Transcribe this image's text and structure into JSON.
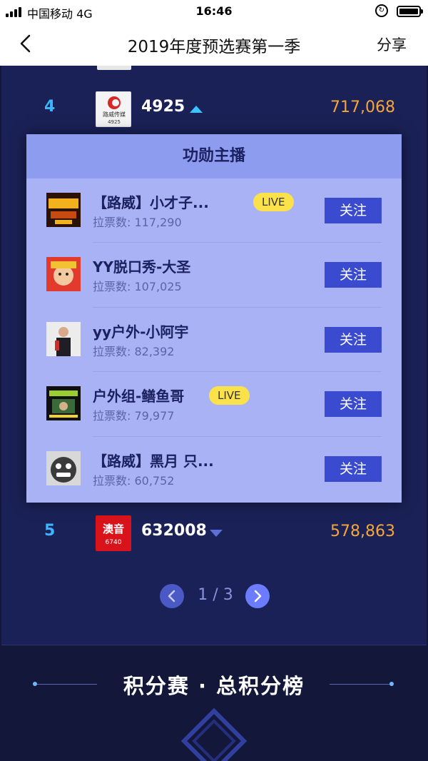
{
  "status_bar": {
    "carrier": "中国移动  4G",
    "time": "16:46"
  },
  "nav": {
    "title": "2019年度预选赛第一季",
    "share_label": "分享"
  },
  "rankings": [
    {
      "rank": "4",
      "name": "4925",
      "score": "717,068",
      "trend": "up",
      "logo_text": "路威传媒",
      "logo_sub": "4925"
    },
    {
      "rank": "5",
      "name": "632008",
      "score": "578,863",
      "trend": "down",
      "logo_text": "澳音",
      "logo_sub": "6740"
    }
  ],
  "hero_card": {
    "title": "功勋主播",
    "follow_label": "关注",
    "live_label": "LIVE",
    "anchors": [
      {
        "name": "【路威】小才子...",
        "votes": "拉票数: 117,290",
        "live": true
      },
      {
        "name": "YY脱口秀-大圣",
        "votes": "拉票数: 107,025",
        "live": false
      },
      {
        "name": "yy户外-小阿宇",
        "votes": "拉票数: 82,392",
        "live": false
      },
      {
        "name": "户外组-鳝鱼哥",
        "votes": "拉票数: 79,977",
        "live": true
      },
      {
        "name": "【路威】黑月 只...",
        "votes": "拉票数: 60,752",
        "live": false
      }
    ]
  },
  "pagination": {
    "text": "1 / 3"
  },
  "bottom_section": {
    "title": "积分赛 · 总积分榜"
  },
  "colors": {
    "background": "#13183a",
    "panel": "#1a2156",
    "rank": "#3cb6ff",
    "score": "#f5a53a",
    "card": "#a8b2f4",
    "button": "#3a4bd0",
    "live": "#fbe24a"
  }
}
